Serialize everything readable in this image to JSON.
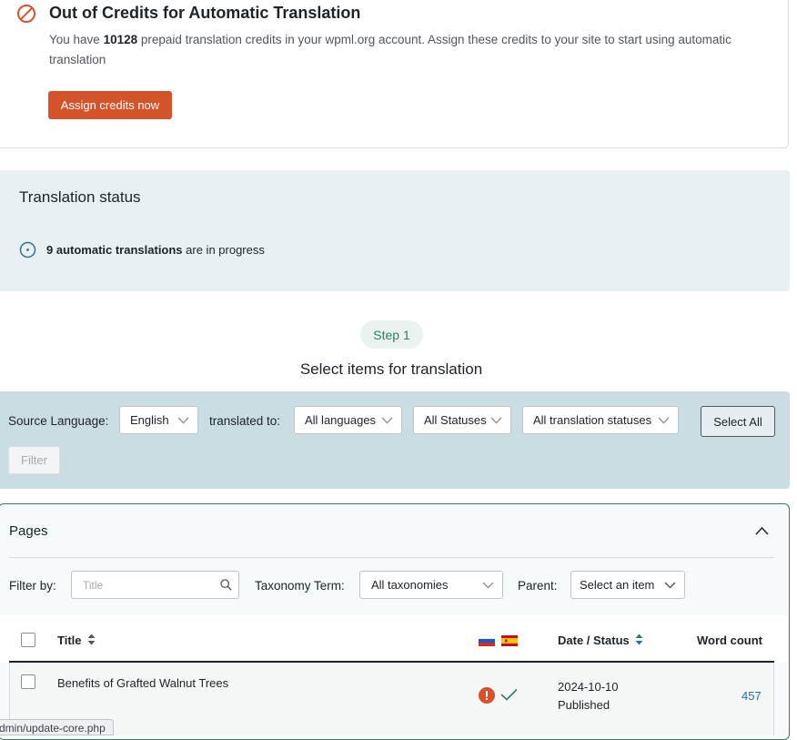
{
  "notice": {
    "title": "Out of Credits for Automatic Translation",
    "text_before": "You have ",
    "credits": "10128",
    "text_after": " prepaid translation credits in your wpml.org account. Assign these credits to your site to start using automatic translation",
    "button_label": "Assign credits now",
    "icon": "prohibited-icon",
    "accent_color": "#d5532a"
  },
  "translation_status": {
    "title": "Translation status",
    "count_text": "9 automatic translations",
    "suffix_text": " are in progress"
  },
  "step": {
    "label": "Step 1",
    "heading": "Select items for translation"
  },
  "filters": {
    "source_language_label": "Source Language:",
    "source_language_value": "English",
    "translated_to_label": "translated to:",
    "languages_value": "All languages",
    "statuses_value": "All Statuses",
    "translation_statuses_value": "All translation statuses",
    "select_all_label": "Select All",
    "filter_label": "Filter"
  },
  "pages": {
    "title": "Pages",
    "filter_by_label": "Filter by:",
    "title_placeholder": "Title",
    "taxonomy_label": "Taxonomy Term:",
    "taxonomy_value": "All taxonomies",
    "parent_label": "Parent:",
    "parent_value": "Select an item",
    "columns": {
      "title": "Title",
      "date_status": "Date / Status",
      "word_count": "Word count"
    },
    "language_flags": [
      "ru-flag-icon",
      "es-flag-icon"
    ],
    "rows": [
      {
        "title": "Benefits of Grafted Walnut Trees",
        "ru_status_icon": "error-icon",
        "es_status_icon": "check-icon",
        "date": "2024-10-10",
        "status": "Published",
        "word_count": "457"
      }
    ]
  },
  "status_bar": {
    "url_text": "dmin/update-core.php"
  }
}
